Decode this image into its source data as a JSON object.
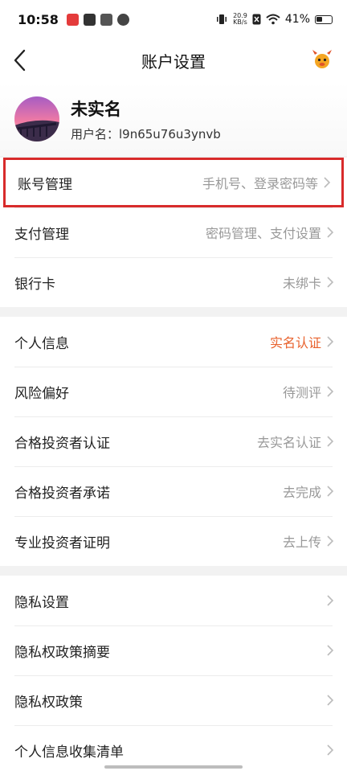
{
  "status_bar": {
    "time": "10:58",
    "net_speed_top": "20.9",
    "net_speed_bottom": "KB/s",
    "battery": "41%"
  },
  "nav": {
    "title": "账户设置"
  },
  "profile": {
    "name": "未实名",
    "username": "用户名：l9n65u76u3ynvb"
  },
  "groups": [
    {
      "rows": [
        {
          "label": "账号管理",
          "value": "手机号、登录密码等"
        },
        {
          "label": "支付管理",
          "value": "密码管理、支付设置"
        },
        {
          "label": "银行卡",
          "value": "未绑卡"
        }
      ]
    },
    {
      "rows": [
        {
          "label": "个人信息",
          "value": "实名认证"
        },
        {
          "label": "风险偏好",
          "value": "待测评"
        },
        {
          "label": "合格投资者认证",
          "value": "去实名认证"
        },
        {
          "label": "合格投资者承诺",
          "value": "去完成"
        },
        {
          "label": "专业投资者证明",
          "value": "去上传"
        }
      ]
    },
    {
      "rows": [
        {
          "label": "隐私设置",
          "value": ""
        },
        {
          "label": "隐私权政策摘要",
          "value": ""
        },
        {
          "label": "隐私权政策",
          "value": ""
        },
        {
          "label": "个人信息收集清单",
          "value": ""
        }
      ]
    }
  ],
  "colors": {
    "accent": "#e8612c",
    "highlight_border": "#d82b2b",
    "muted_text": "#999999"
  },
  "icons": {
    "back": "chevron-left-icon",
    "mascot": "mascot-icon",
    "row_arrow": "chevron-right-icon"
  }
}
